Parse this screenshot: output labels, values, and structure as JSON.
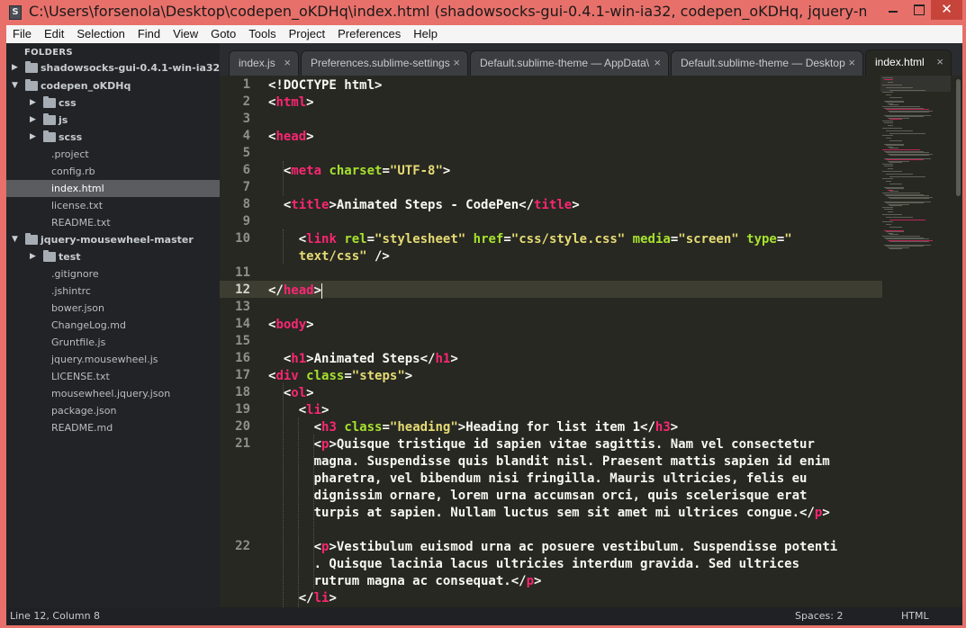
{
  "window": {
    "title": "C:\\Users\\forsenola\\Desktop\\codepen_oKDHq\\index.html (shadowsocks-gui-0.4.1-win-ia32, codepen_oKDHq, jquery-mousewh...",
    "app_icon": "S",
    "close_glyph": "✕"
  },
  "menu": [
    "File",
    "Edit",
    "Selection",
    "Find",
    "View",
    "Goto",
    "Tools",
    "Project",
    "Preferences",
    "Help"
  ],
  "sidebar": {
    "header": "FOLDERS",
    "items": [
      {
        "label": "shadowsocks-gui-0.4.1-win-ia32",
        "type": "folder",
        "expanded": false,
        "depth": 0
      },
      {
        "label": "codepen_oKDHq",
        "type": "folder",
        "expanded": true,
        "depth": 0
      },
      {
        "label": "css",
        "type": "folder",
        "expanded": false,
        "depth": 1
      },
      {
        "label": "js",
        "type": "folder",
        "expanded": false,
        "depth": 1
      },
      {
        "label": "scss",
        "type": "folder",
        "expanded": false,
        "depth": 1
      },
      {
        "label": ".project",
        "type": "file",
        "depth": 1
      },
      {
        "label": "config.rb",
        "type": "file",
        "depth": 1
      },
      {
        "label": "index.html",
        "type": "file",
        "depth": 1,
        "selected": true
      },
      {
        "label": "license.txt",
        "type": "file",
        "depth": 1
      },
      {
        "label": "README.txt",
        "type": "file",
        "depth": 1
      },
      {
        "label": "jquery-mousewheel-master",
        "type": "folder",
        "expanded": true,
        "depth": 0
      },
      {
        "label": "test",
        "type": "folder",
        "expanded": false,
        "depth": 1
      },
      {
        "label": ".gitignore",
        "type": "file",
        "depth": 1
      },
      {
        "label": ".jshintrc",
        "type": "file",
        "depth": 1
      },
      {
        "label": "bower.json",
        "type": "file",
        "depth": 1
      },
      {
        "label": "ChangeLog.md",
        "type": "file",
        "depth": 1
      },
      {
        "label": "Gruntfile.js",
        "type": "file",
        "depth": 1
      },
      {
        "label": "jquery.mousewheel.js",
        "type": "file",
        "depth": 1
      },
      {
        "label": "LICENSE.txt",
        "type": "file",
        "depth": 1
      },
      {
        "label": "mousewheel.jquery.json",
        "type": "file",
        "depth": 1
      },
      {
        "label": "package.json",
        "type": "file",
        "depth": 1
      },
      {
        "label": "README.md",
        "type": "file",
        "depth": 1
      }
    ]
  },
  "tabs": [
    {
      "label": "index.js",
      "active": false,
      "close": "×"
    },
    {
      "label": "Preferences.sublime-settings",
      "active": false,
      "close": "×"
    },
    {
      "label": "Default.sublime-theme — AppData\\",
      "active": false,
      "close": "×"
    },
    {
      "label": "Default.sublime-theme — Desktop",
      "active": false,
      "close": "×"
    },
    {
      "label": "index.html",
      "active": true,
      "close": "×"
    }
  ],
  "editor": {
    "current_line": 12,
    "line_numbers": [
      "1",
      "2",
      "3",
      "4",
      "5",
      "6",
      "7",
      "8",
      "9",
      "10",
      "11",
      "12",
      "13",
      "14",
      "15",
      "16",
      "17",
      "18",
      "19",
      "20",
      "21",
      "22",
      "23"
    ],
    "lines": [
      [
        [
          "p",
          "<!DOCTYPE html>"
        ]
      ],
      [
        [
          "p",
          "<"
        ],
        [
          "t",
          "html"
        ],
        [
          "p",
          ">"
        ]
      ],
      [],
      [
        [
          "p",
          "<"
        ],
        [
          "t",
          "head"
        ],
        [
          "p",
          ">"
        ]
      ],
      [],
      [
        [
          "p",
          "  <"
        ],
        [
          "t",
          "meta"
        ],
        [
          "p",
          " "
        ],
        [
          "a",
          "charset"
        ],
        [
          "p",
          "="
        ],
        [
          "s",
          "\"UTF-8\""
        ],
        [
          "p",
          ">"
        ]
      ],
      [],
      [
        [
          "p",
          "  <"
        ],
        [
          "t",
          "title"
        ],
        [
          "p",
          ">Animated Steps - CodePen</"
        ],
        [
          "t",
          "title"
        ],
        [
          "p",
          ">"
        ]
      ],
      [],
      [
        [
          "p",
          "    <"
        ],
        [
          "t",
          "link"
        ],
        [
          "p",
          " "
        ],
        [
          "a",
          "rel"
        ],
        [
          "p",
          "="
        ],
        [
          "s",
          "\"stylesheet\""
        ],
        [
          "p",
          " "
        ],
        [
          "a",
          "href"
        ],
        [
          "p",
          "="
        ],
        [
          "s",
          "\"css/style.css\""
        ],
        [
          "p",
          " "
        ],
        [
          "a",
          "media"
        ],
        [
          "p",
          "="
        ],
        [
          "s",
          "\"screen\""
        ],
        [
          "p",
          " "
        ],
        [
          "a",
          "type"
        ],
        [
          "p",
          "="
        ],
        [
          "s",
          "\""
        ]
      ],
      [
        [
          "s",
          "    text/css\""
        ],
        [
          "p",
          " />"
        ]
      ],
      [],
      [
        [
          "p",
          "</"
        ],
        [
          "t",
          "head"
        ],
        [
          "p",
          ">"
        ]
      ],
      [],
      [
        [
          "p",
          "<"
        ],
        [
          "t",
          "body"
        ],
        [
          "p",
          ">"
        ]
      ],
      [],
      [
        [
          "p",
          "  <"
        ],
        [
          "t",
          "h1"
        ],
        [
          "p",
          ">Animated Steps</"
        ],
        [
          "t",
          "h1"
        ],
        [
          "p",
          ">"
        ]
      ],
      [
        [
          "p",
          "<"
        ],
        [
          "t",
          "div"
        ],
        [
          "p",
          " "
        ],
        [
          "a",
          "class"
        ],
        [
          "p",
          "="
        ],
        [
          "s",
          "\"steps\""
        ],
        [
          "p",
          ">"
        ]
      ],
      [
        [
          "p",
          "  <"
        ],
        [
          "t",
          "ol"
        ],
        [
          "p",
          ">"
        ]
      ],
      [
        [
          "p",
          "    <"
        ],
        [
          "t",
          "li"
        ],
        [
          "p",
          ">"
        ]
      ],
      [
        [
          "p",
          "      <"
        ],
        [
          "t",
          "h3"
        ],
        [
          "p",
          " "
        ],
        [
          "a",
          "class"
        ],
        [
          "p",
          "="
        ],
        [
          "s",
          "\"heading\""
        ],
        [
          "p",
          ">Heading for list item 1</"
        ],
        [
          "t",
          "h3"
        ],
        [
          "p",
          ">"
        ]
      ],
      [
        [
          "p",
          "      <"
        ],
        [
          "t",
          "p"
        ],
        [
          "p",
          ">Quisque tristique id sapien vitae sagittis. Nam vel consectetur"
        ]
      ],
      [
        [
          "p",
          "      magna. Suspendisse quis blandit nisl. Praesent mattis sapien id enim"
        ]
      ],
      [
        [
          "p",
          "      pharetra, vel bibendum nisi fringilla. Mauris ultricies, felis eu"
        ]
      ],
      [
        [
          "p",
          "      dignissim ornare, lorem urna accumsan orci, quis scelerisque erat"
        ]
      ],
      [
        [
          "p",
          "      turpis at sapien. Nullam luctus sem sit amet mi ultrices congue.</"
        ],
        [
          "t",
          "p"
        ],
        [
          "p",
          ">"
        ]
      ],
      [],
      [
        [
          "p",
          "      <"
        ],
        [
          "t",
          "p"
        ],
        [
          "p",
          ">Vestibulum euismod urna ac posuere vestibulum. Suspendisse potenti"
        ]
      ],
      [
        [
          "p",
          "      . Quisque lacinia lacus ultricies interdum gravida. Sed ultrices"
        ]
      ],
      [
        [
          "p",
          "      rutrum magna ac consequat.</"
        ],
        [
          "t",
          "p"
        ],
        [
          "p",
          ">"
        ]
      ],
      [
        [
          "p",
          "    </"
        ],
        [
          "t",
          "li"
        ],
        [
          "p",
          ">"
        ]
      ]
    ]
  },
  "status": {
    "position": "Line 12, Column 8",
    "spaces": "Spaces: 2",
    "syntax": "HTML"
  }
}
